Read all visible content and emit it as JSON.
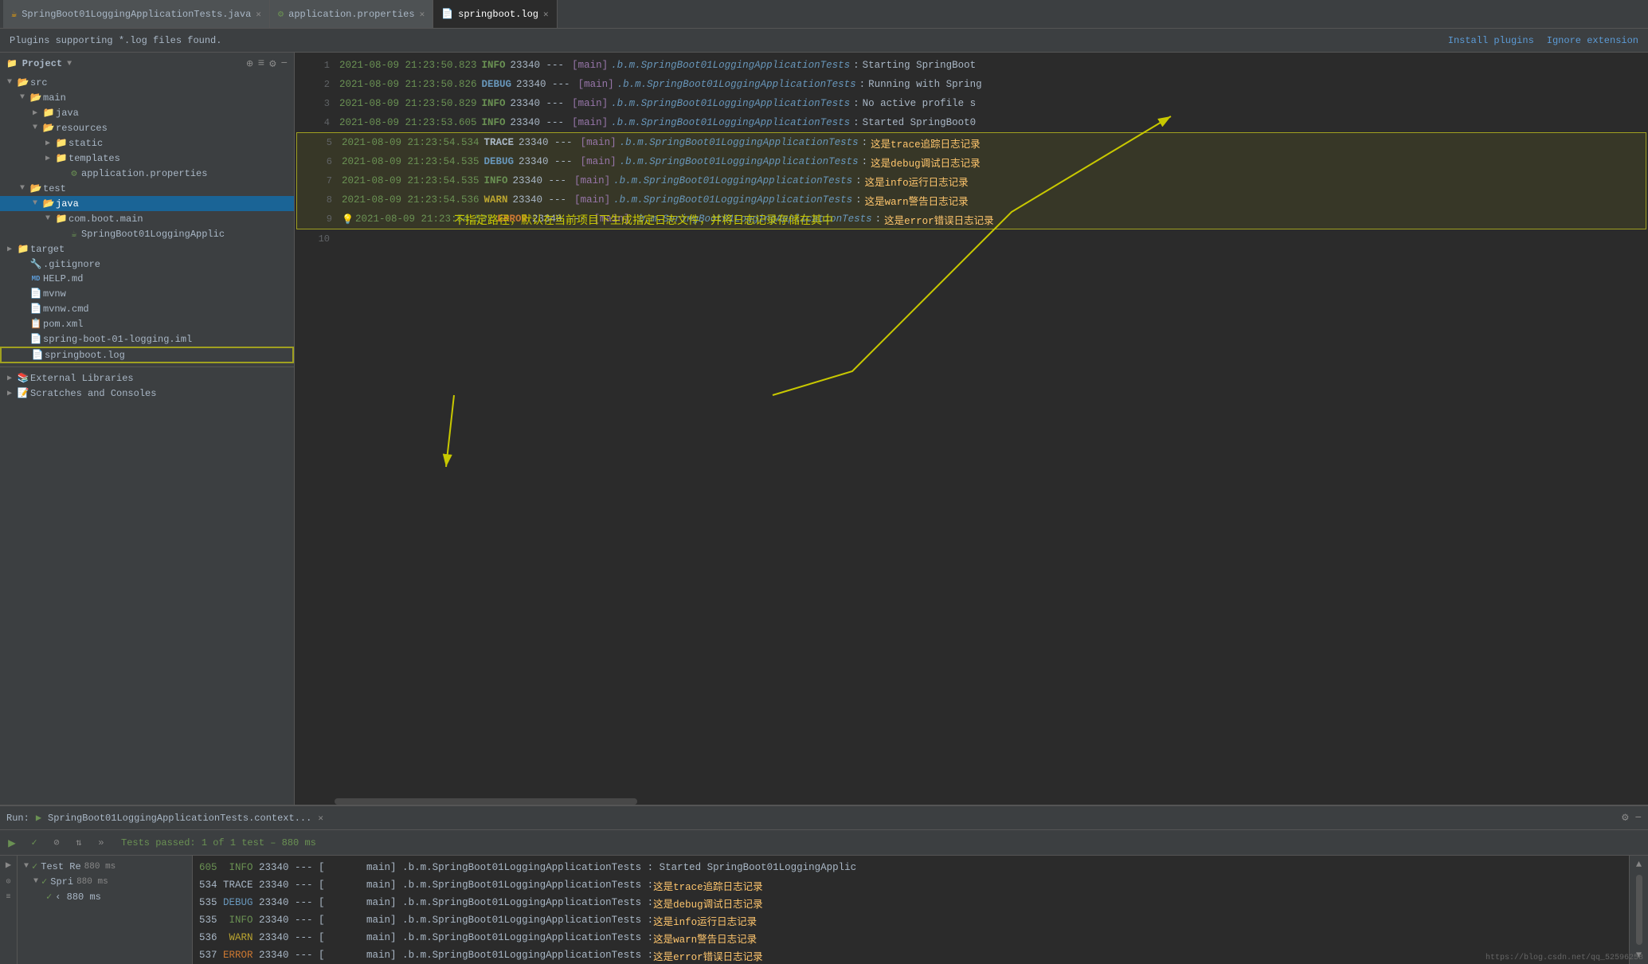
{
  "tabs": [
    {
      "id": "tab1",
      "label": "SpringBoot01LoggingApplicationTests.java",
      "icon": "java",
      "active": false,
      "closable": true
    },
    {
      "id": "tab2",
      "label": "application.properties",
      "icon": "properties",
      "active": false,
      "closable": true
    },
    {
      "id": "tab3",
      "label": "springboot.log",
      "icon": "log",
      "active": true,
      "closable": true
    }
  ],
  "plugin_bar": {
    "message": "Plugins supporting *.log files found.",
    "install_label": "Install plugins",
    "ignore_label": "Ignore extension"
  },
  "sidebar": {
    "title": "Project",
    "tree": [
      {
        "id": "src",
        "label": "src",
        "level": 0,
        "type": "folder-src",
        "expanded": true,
        "arrow": "▼"
      },
      {
        "id": "main",
        "label": "main",
        "level": 1,
        "type": "folder",
        "expanded": true,
        "arrow": "▼"
      },
      {
        "id": "java",
        "label": "java",
        "level": 2,
        "type": "folder",
        "expanded": false,
        "arrow": "▶"
      },
      {
        "id": "resources",
        "label": "resources",
        "level": 2,
        "type": "folder",
        "expanded": true,
        "arrow": "▼"
      },
      {
        "id": "static",
        "label": "static",
        "level": 3,
        "type": "folder",
        "expanded": false,
        "arrow": "▶"
      },
      {
        "id": "templates",
        "label": "templates",
        "level": 3,
        "type": "folder",
        "expanded": false,
        "arrow": "▶"
      },
      {
        "id": "application.properties",
        "label": "application.properties",
        "level": 3,
        "type": "properties",
        "expanded": false,
        "arrow": ""
      },
      {
        "id": "test",
        "label": "test",
        "level": 1,
        "type": "folder",
        "expanded": true,
        "arrow": "▼"
      },
      {
        "id": "java2",
        "label": "java",
        "level": 2,
        "type": "folder",
        "expanded": true,
        "arrow": "▼",
        "selected": true
      },
      {
        "id": "com.boot.main",
        "label": "com.boot.main",
        "level": 3,
        "type": "folder",
        "expanded": true,
        "arrow": "▼"
      },
      {
        "id": "SpringBoot01LoggingApplic",
        "label": "SpringBoot01LoggingApplic",
        "level": 4,
        "type": "java",
        "expanded": false,
        "arrow": ""
      },
      {
        "id": "target",
        "label": "target",
        "level": 0,
        "type": "folder",
        "expanded": false,
        "arrow": "▶"
      },
      {
        "id": ".gitignore",
        "label": ".gitignore",
        "level": 0,
        "type": "gitignore",
        "expanded": false,
        "arrow": ""
      },
      {
        "id": "HELP.md",
        "label": "HELP.md",
        "level": 0,
        "type": "md",
        "expanded": false,
        "arrow": ""
      },
      {
        "id": "mvnw",
        "label": "mvnw",
        "level": 0,
        "type": "file",
        "expanded": false,
        "arrow": ""
      },
      {
        "id": "mvnw.cmd",
        "label": "mvnw.cmd",
        "level": 0,
        "type": "file",
        "expanded": false,
        "arrow": ""
      },
      {
        "id": "pom.xml",
        "label": "pom.xml",
        "level": 0,
        "type": "xml",
        "expanded": false,
        "arrow": ""
      },
      {
        "id": "spring-boot-01-logging.iml",
        "label": "spring-boot-01-logging.iml",
        "level": 0,
        "type": "iml",
        "expanded": false,
        "arrow": ""
      },
      {
        "id": "springboot.log",
        "label": "springboot.log",
        "level": 0,
        "type": "log",
        "expanded": false,
        "arrow": "",
        "highlighted": true
      }
    ],
    "external_libraries": "External Libraries",
    "scratches": "Scratches and Consoles"
  },
  "log_lines": [
    {
      "num": "1",
      "timestamp": "2021-08-09 21:23:50.823",
      "level": "INFO",
      "pid": "23340",
      "sep": "---",
      "thread": "[main]",
      "class": ".b.m.SpringBoot01LoggingApplicationTests",
      "colon": ":",
      "msg": "Starting SpringBoot",
      "highlight": false
    },
    {
      "num": "2",
      "timestamp": "2021-08-09 21:23:50.826",
      "level": "DEBUG",
      "pid": "23340",
      "sep": "---",
      "thread": "[main]",
      "class": ".b.m.SpringBoot01LoggingApplicationTests",
      "colon": ":",
      "msg": "Running with Spring",
      "highlight": false
    },
    {
      "num": "3",
      "timestamp": "2021-08-09 21:23:50.829",
      "level": "INFO",
      "pid": "23340",
      "sep": "---",
      "thread": "[main]",
      "class": ".b.m.SpringBoot01LoggingApplicationTests",
      "colon": ":",
      "msg": "No active profile s",
      "highlight": false
    },
    {
      "num": "4",
      "timestamp": "2021-08-09 21:23:53.605",
      "level": "INFO",
      "pid": "23340",
      "sep": "---",
      "thread": "[main]",
      "class": ".b.m.SpringBoot01LoggingApplicationTests",
      "colon": ":",
      "msg": "Started SpringBoot0",
      "highlight": false
    },
    {
      "num": "5",
      "timestamp": "2021-08-09 21:23:54.534",
      "level": "TRACE",
      "pid": "23340",
      "sep": "---",
      "thread": "[main]",
      "class": ".b.m.SpringBoot01LoggingApplicationTests",
      "colon": ":",
      "msg": "这是trace追踪日志记录",
      "highlight": true
    },
    {
      "num": "6",
      "timestamp": "2021-08-09 21:23:54.535",
      "level": "DEBUG",
      "pid": "23340",
      "sep": "---",
      "thread": "[main]",
      "class": ".b.m.SpringBoot01LoggingApplicationTests",
      "colon": ":",
      "msg": "这是debug调试日志记录",
      "highlight": true
    },
    {
      "num": "7",
      "timestamp": "2021-08-09 21:23:54.535",
      "level": "INFO",
      "pid": "23340",
      "sep": "---",
      "thread": "[main]",
      "class": ".b.m.SpringBoot01LoggingApplicationTests",
      "colon": ":",
      "msg": "这是info运行日志记录",
      "highlight": true
    },
    {
      "num": "8",
      "timestamp": "2021-08-09 21:23:54.536",
      "level": "WARN",
      "pid": "23340",
      "sep": "---",
      "thread": "[main]",
      "class": ".b.m.SpringBoot01LoggingApplicationTests",
      "colon": ":",
      "msg": "这是warn警告日志记录",
      "highlight": true
    },
    {
      "num": "9",
      "timestamp": "2021-08-09 21:23:54.537",
      "level": "ERROR",
      "pid": "23340",
      "sep": "---",
      "thread": "[main]",
      "class": ".b.m.SpringBoot01LoggingApplicationTests",
      "colon": ":",
      "msg": "这是error错误日志记录",
      "highlight": true,
      "has_bulb": true
    },
    {
      "num": "10",
      "timestamp": "",
      "level": "",
      "pid": "",
      "sep": "",
      "thread": "",
      "class": "",
      "colon": "",
      "msg": "",
      "highlight": false
    }
  ],
  "annotation": {
    "text": "不指定路径，默认在当前项目下生成指定日志文件，并将日志记录存储在其中",
    "color": "#c8c800"
  },
  "run_panel": {
    "label": "Run:",
    "tab_name": "SpringBoot01LoggingApplicationTests.context...",
    "toolbar": {
      "play": "▶",
      "check": "✓",
      "stop": "⊘",
      "rerun": "⇅",
      "expand": "»"
    },
    "status": "Tests passed: 1 of 1 test – 880 ms",
    "test_items": [
      {
        "label": "Test Re",
        "time": "880 ms",
        "level": 0,
        "pass": true,
        "expanded": true
      },
      {
        "label": "Spri",
        "time": "880 ms",
        "level": 1,
        "pass": true,
        "expanded": true
      },
      {
        "label": "‹ 880 ms",
        "time": "",
        "level": 2,
        "pass": true,
        "expanded": false
      }
    ],
    "log_lines": [
      {
        "content": "605  INFO 23340 --- [       main] .b.m.SpringBoot01LoggingApplicationTests : Started SpringBoot01LoggingApplic"
      },
      {
        "content": "534 TRACE 23340 --- [       main] .b.m.SpringBoot01LoggingApplicationTests : 这是trace追踪日志记录"
      },
      {
        "content": "535 DEBUG 23340 --- [       main] .b.m.SpringBoot01LoggingApplicationTests : 这是debug调试日志记录"
      },
      {
        "content": "535  INFO 23340 --- [       main] .b.m.SpringBoot01LoggingApplicationTests : 这是info运行日志记录"
      },
      {
        "content": "536  WARN 23340 --- [       main] .b.m.SpringBoot01LoggingApplicationTests : 这是warn警告日志记录"
      },
      {
        "content": "537 ERROR 23340 --- [       main] .b.m.SpringBoot01LoggingApplicationTests : 这是error错误日志记录"
      }
    ]
  },
  "watermark": "https://blog.csdn.net/qq_52596258",
  "colors": {
    "accent_yellow": "#c8c800",
    "info_green": "#6a9153",
    "debug_blue": "#6897bb",
    "trace_gray": "#a9b7c6",
    "warn_yellow": "#bba530",
    "error_orange": "#cc7832"
  }
}
